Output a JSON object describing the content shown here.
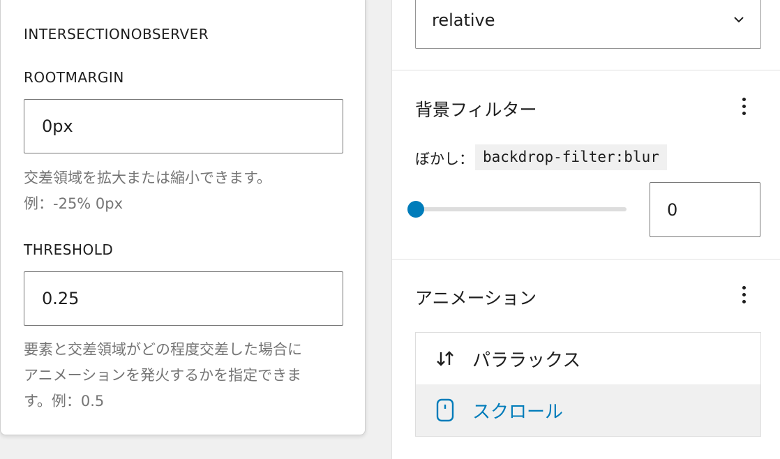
{
  "popover": {
    "group_heading": "INTERSECTIONOBSERVER",
    "rootmargin": {
      "label": "ROOTMARGIN",
      "value": "0px",
      "help_line1": "交差領域を拡大または縮小できます。",
      "help_line2": "例：-25% 0px"
    },
    "threshold": {
      "label": "THRESHOLD",
      "value": "0.25",
      "help_line1": "要素と交差領域がどの程度交差した場合に",
      "help_line2": "アニメーションを発火するかを指定できま",
      "help_line3": "す。例：0.5"
    }
  },
  "sidebar": {
    "position_select": {
      "value": "relative",
      "icon": "chevron-down-icon"
    },
    "backdrop": {
      "title": "背景フィルター",
      "blur_label": "ぼかし：",
      "code": "backdrop-filter:blur",
      "range_value": 0,
      "number_value": "0",
      "accent": "#007cba"
    },
    "animation": {
      "title": "アニメーション",
      "items": [
        {
          "label": "パララックス",
          "icon": "arrows-up-down-icon",
          "active": false
        },
        {
          "label": "スクロール",
          "icon": "mouse-icon",
          "active": true
        }
      ]
    }
  }
}
